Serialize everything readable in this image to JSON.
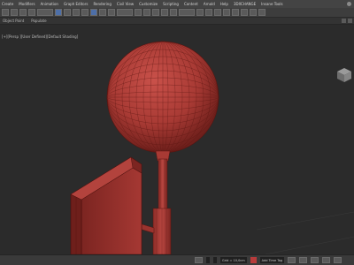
{
  "menu": [
    "Create",
    "Modifiers",
    "Animation",
    "Graph Editors",
    "Rendering",
    "Civil View",
    "Customize",
    "Scripting",
    "Content",
    "Arnold",
    "Help",
    "3DXCHANGE",
    "Insane Tools"
  ],
  "tabs": [
    "Object Paint",
    "Populate"
  ],
  "viewport": {
    "label": "[+][Persp ][User Defined][Default Shading]"
  },
  "status": {
    "grid": "Grid = 10,0cm",
    "time_tag": "Add Time Tag"
  },
  "colors": {
    "model": "#a83a34",
    "model_dark": "#6e1f1b",
    "wire": "#5a1511",
    "background": "#2b2b2b"
  }
}
